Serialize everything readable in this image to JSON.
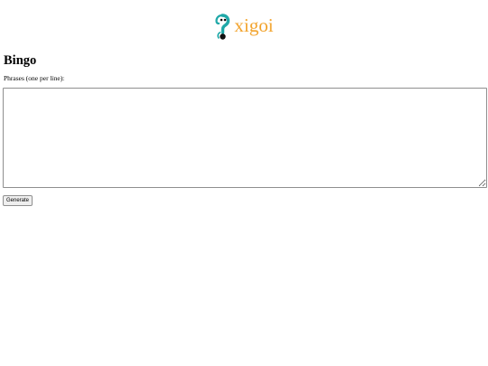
{
  "header": {
    "logo_text": "xigoi",
    "logo_icon": "xigoi-logo-icon",
    "logo_text_color": "#f2a32c",
    "logo_icon_color": "#1fa8a8"
  },
  "main": {
    "title": "Bingo",
    "phrases_label": "Phrases (one per line):",
    "phrases_value": "",
    "generate_label": "Generate"
  }
}
